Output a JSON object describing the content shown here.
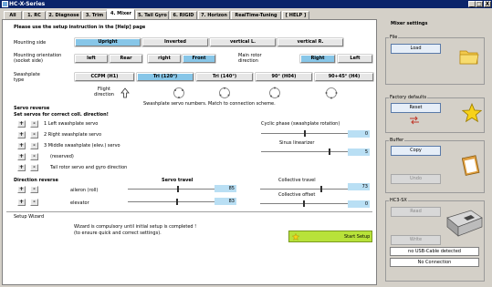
{
  "window": {
    "title": "HC-X-Series",
    "buttons": [
      "_",
      "□",
      "X"
    ]
  },
  "tabs": [
    "All",
    "1. RC",
    "2. Diagnose",
    "3. Trim",
    "4. Mixer",
    "5. Tail Gyro",
    "6. RIGID",
    "7. Horizon",
    "RealTime-Tuning",
    "[ HELP ]"
  ],
  "active_tab": "4. Mixer",
  "main": {
    "instruction": "Please use the setup instruction in the [Help] page",
    "mounting_side": {
      "label": "Mounting side",
      "options": [
        "Upright",
        "Inverted",
        "vertical L.",
        "vertical R."
      ],
      "selected": "Upright"
    },
    "mounting_orientation": {
      "label": "Mounting orientation (socket side)",
      "options": [
        "left",
        "Rear",
        "right",
        "Front"
      ],
      "selected": "Front"
    },
    "main_rotor_direction": {
      "label": "Main rotor direction",
      "options": [
        "Right",
        "Left"
      ],
      "selected": "Right"
    },
    "swashplate_type": {
      "label": "Swashplate type",
      "options": [
        "CCPM (H1)",
        "Tri (120°)",
        "Tri (140°)",
        "90° (H04)",
        "90+45° (H4)"
      ],
      "selected": "Tri (120°)"
    },
    "flight_direction": "Flight direction",
    "servo_caption": "Swashplate servo numbers. Match to connection scheme.",
    "servo_reverse": {
      "title": "Servo reverse",
      "subtitle": "Set servos for correct coll. direction!",
      "rows": [
        "1  Left swashplate servo",
        "2  Right swashplate servo",
        "3  Middle swashplate (elev.) servo",
        "(reserved)",
        "Tail rotor servo and gyro direction"
      ]
    },
    "cyclic_phase": {
      "label": "Cyclic phase (swashplate rotation)",
      "value": "0"
    },
    "sinus_linearizer": {
      "label": "Sinus linearizer",
      "value": "5"
    },
    "direction_reverse": {
      "title": "Direction reverse",
      "servo_travel_title": "Servo travel",
      "rows": [
        {
          "label": "aileron (roll)",
          "value": "85"
        },
        {
          "label": "elevator",
          "value": "83"
        }
      ]
    },
    "collective_travel": {
      "label": "Collective travel",
      "value": "73"
    },
    "collective_offset": {
      "label": "Collective offset",
      "value": "0"
    },
    "setup_wizard": {
      "title": "Setup Wizard",
      "message_line1": "Wizard is compulsory until initial setup is completed !",
      "message_line2": "(to ensure quick and correct settings).",
      "start_label": "Start Setup"
    },
    "buttons": {
      "plus": "+",
      "minus": "-"
    }
  },
  "sidebar": {
    "title": "Mixer settings",
    "file": {
      "label": "File",
      "button": "Load"
    },
    "factory": {
      "label": "Factory defaults",
      "button": "Reset"
    },
    "buffer": {
      "label": "Buffer",
      "copy": "Copy",
      "undo": "Undo"
    },
    "hc3": {
      "label": "HC3-SX",
      "read": "Read",
      "write": "Write",
      "status1": "no USB-Cable detected",
      "status2": "No Connection"
    }
  },
  "colors": {
    "selected": "#87c6e8",
    "value_bg": "#b9dff4",
    "start_btn": "#b8e23a",
    "titlebar": "#0a246a"
  }
}
